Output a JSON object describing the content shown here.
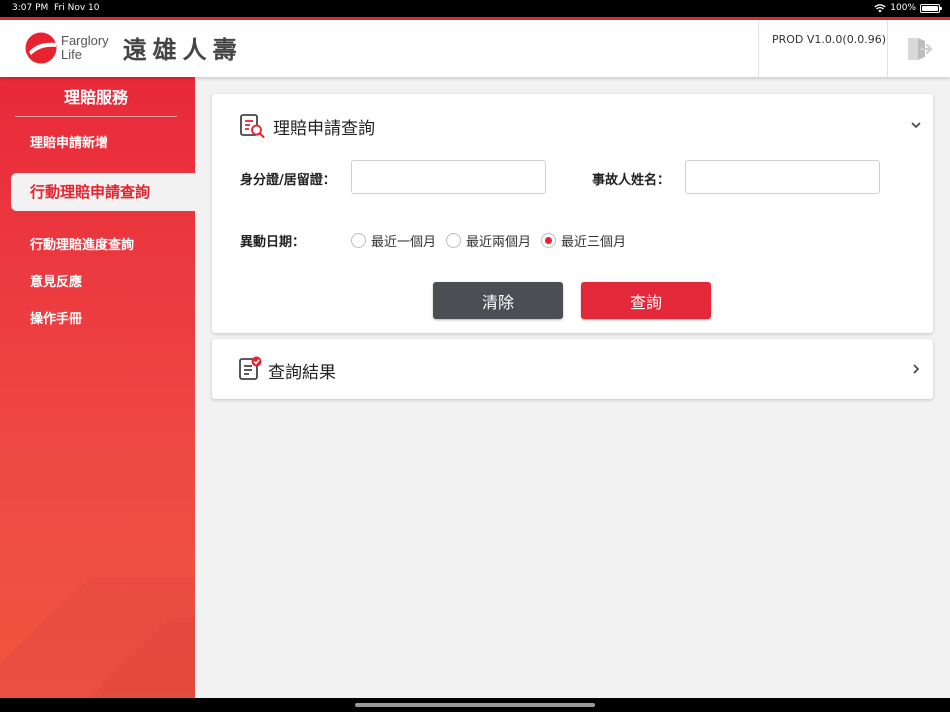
{
  "status_bar": {
    "time": "3:07 PM",
    "date": "Fri Nov 10",
    "battery": "100%",
    "battery_level": 1.0
  },
  "header": {
    "logo_en_line1": "Farglory",
    "logo_en_line2": "Life",
    "logo_zh": "遠雄人壽",
    "version": "PROD V1.0.0(0.0.96)",
    "logout_icon": "logout-door-icon"
  },
  "sidebar": {
    "title": "理賠服務",
    "items": [
      {
        "label": "理賠申請新增"
      },
      {
        "label": "行動理賠申請查詢"
      },
      {
        "label": "行動理賠進度查詢"
      },
      {
        "label": "意見反應"
      },
      {
        "label": "操作手冊"
      }
    ],
    "active_index": 1
  },
  "query_card": {
    "title": "理賠申請查詢",
    "id_label": "身分證/居留證：",
    "id_value": "",
    "name_label": "事故人姓名：",
    "name_value": "",
    "date_label": "異動日期：",
    "date_options": [
      "最近一個月",
      "最近兩個月",
      "最近三個月"
    ],
    "date_selected": 2,
    "clear_label": "清除",
    "search_label": "查詢"
  },
  "result_card": {
    "title": "查詢結果"
  },
  "colors": {
    "brand_red": "#e8232f",
    "clear_button": "#4b4f54",
    "background": "#f2f2f2"
  }
}
